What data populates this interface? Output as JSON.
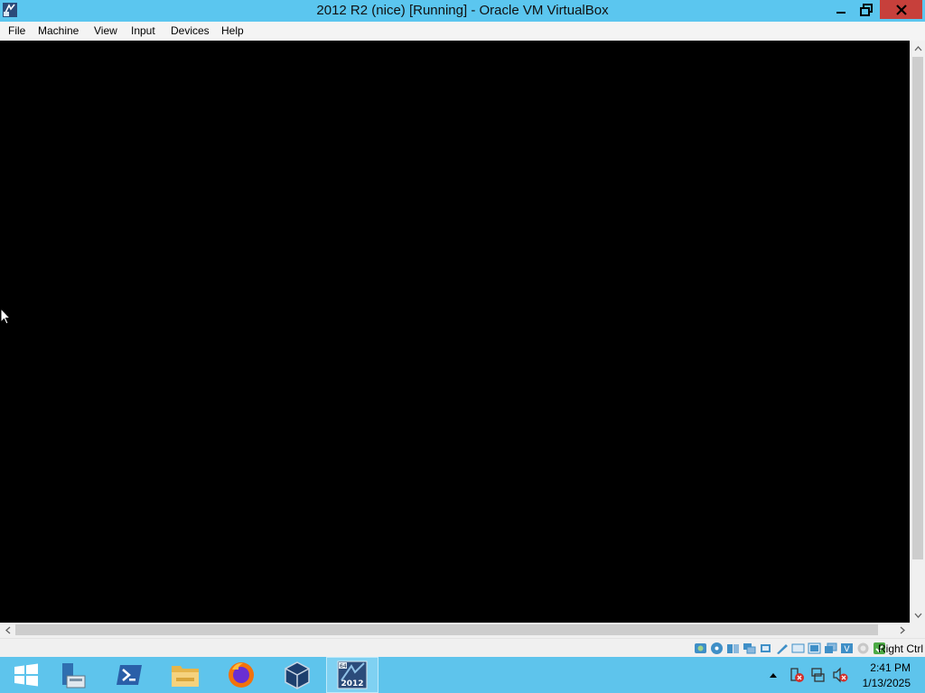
{
  "window": {
    "title": "2012 R2 (nice) [Running] - Oracle VM VirtualBox",
    "controls": [
      "minimize-icon",
      "restore-icon",
      "close-icon"
    ]
  },
  "menubar": {
    "items": [
      "File",
      "Machine",
      "View",
      "Input",
      "Devices",
      "Help"
    ]
  },
  "statusbar": {
    "icons": [
      "hard-disk-icon",
      "optical-disk-icon",
      "audio-icon",
      "network-icon",
      "usb-icon",
      "shared-folders-icon",
      "display-icon",
      "video-capture-icon",
      "virtualization-icon",
      "cpu-icon",
      "mouse-integration-icon",
      "keyboard-icon"
    ],
    "host_key": "Right Ctrl"
  },
  "taskbar": {
    "apps": [
      "windows-start-icon",
      "server-manager-icon",
      "powershell-icon",
      "file-explorer-icon",
      "firefox-icon",
      "virtualbox-icon"
    ],
    "active_app": {
      "icon": "vm-2012-icon",
      "badge_top": "64",
      "badge": "2012"
    }
  },
  "tray": {
    "icons": [
      "show-hidden-icons-chevron",
      "action-center-icon",
      "network-icon",
      "volume-muted-icon"
    ],
    "time": "2:41 PM",
    "date": "1/13/2025"
  },
  "colors": {
    "titlebar": "#5bc6ef",
    "taskbar": "#5ec4ec",
    "close_button": "#c7403b",
    "vm_screen": "#000000"
  }
}
